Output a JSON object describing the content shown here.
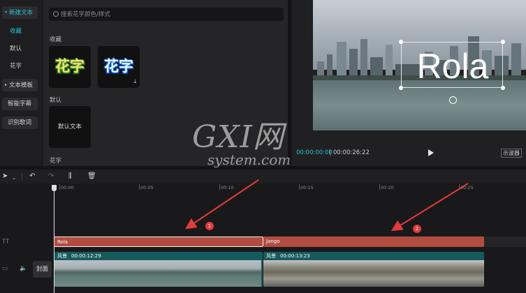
{
  "nav": {
    "new_text": "新建文本",
    "collect": "收藏",
    "default": "默认",
    "fancy": "花字",
    "text_template": "文本模板",
    "smart_caption": "智能字幕",
    "lyrics": "识别歌词"
  },
  "panel": {
    "search_placeholder": "搜索花字颜色/样式",
    "section_collect": "收藏",
    "card1_text": "花字",
    "card2_text": "花字",
    "section_default": "默认",
    "default_card": "默认文本",
    "section_fancy": "花字"
  },
  "preview": {
    "overlay_text": "Rola",
    "current_time": "00:00:00:00",
    "total_time": "00:00:26:22",
    "ratio_label": "示波器"
  },
  "ruler": [
    "00:00",
    "00:05",
    "00:10",
    "00:15",
    "00:20",
    "00:25"
  ],
  "tracks": {
    "text_icon": "TT",
    "clip1": "Rola",
    "clip2": "Jango",
    "cover": "封面",
    "video1_name": "风景",
    "video1_time": "00:00:12:29",
    "video2_name": "风景",
    "video2_time": "00:00:13:23"
  },
  "annotations": [
    "1",
    "2"
  ],
  "watermark": {
    "main": "GXI网",
    "sub": "system.com"
  },
  "colors": {
    "accent": "#25c2d3",
    "text_clip": "#b24c40",
    "video_clip": "#175a5e",
    "arrow": "#e23b3b"
  }
}
